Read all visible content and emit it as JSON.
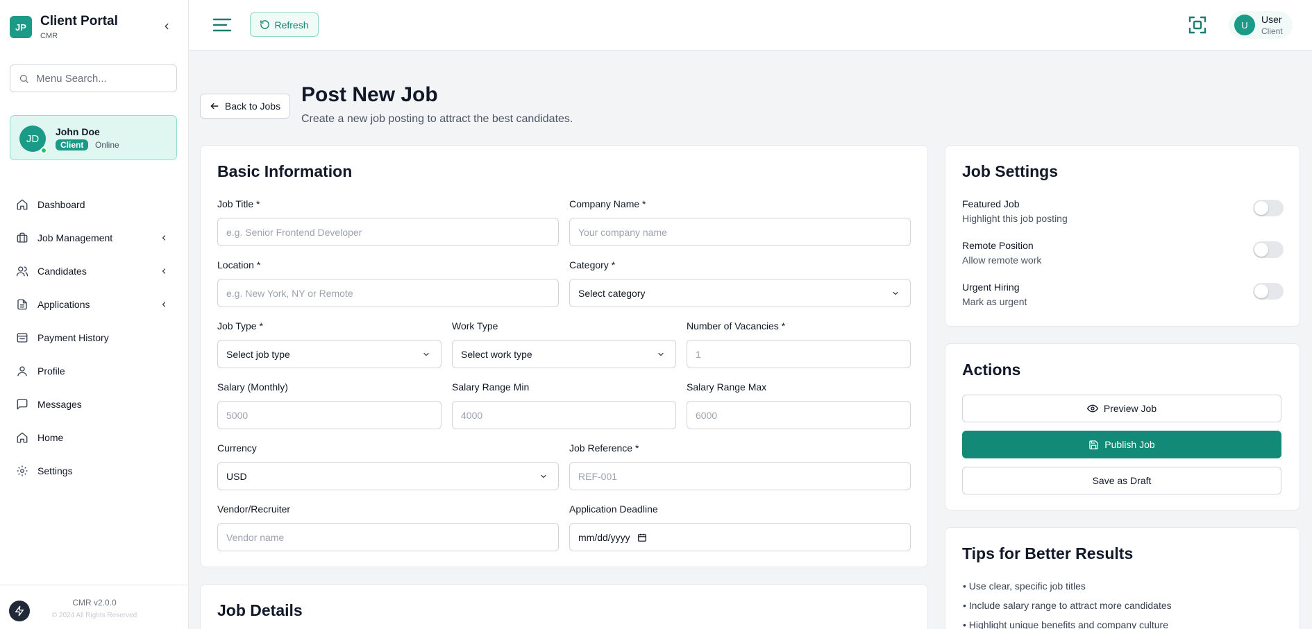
{
  "brand": {
    "logo": "JP",
    "title": "Client Portal",
    "subtitle": "CMR"
  },
  "search": {
    "placeholder": "Menu Search..."
  },
  "user": {
    "initials": "JD",
    "name": "John Doe",
    "role": "Client",
    "status": "Online"
  },
  "nav": {
    "items": [
      {
        "label": "Dashboard",
        "icon": "home-icon"
      },
      {
        "label": "Job Management",
        "icon": "briefcase-icon",
        "expandable": true
      },
      {
        "label": "Candidates",
        "icon": "users-icon",
        "expandable": true
      },
      {
        "label": "Applications",
        "icon": "file-icon",
        "expandable": true
      },
      {
        "label": "Payment History",
        "icon": "receipt-icon"
      },
      {
        "label": "Profile",
        "icon": "user-icon"
      },
      {
        "label": "Messages",
        "icon": "message-icon"
      },
      {
        "label": "Home",
        "icon": "home-icon"
      },
      {
        "label": "Settings",
        "icon": "gear-icon"
      }
    ]
  },
  "footer": {
    "version": "CMR v2.0.0",
    "copyright": "© 2024 All Rights Reserved"
  },
  "topbar": {
    "refresh_label": "Refresh",
    "user_initial": "U",
    "user_name": "User",
    "user_role": "Client"
  },
  "page": {
    "back_label": "Back to Jobs",
    "title": "Post New Job",
    "subtitle": "Create a new job posting to attract the best candidates."
  },
  "basic_info": {
    "title": "Basic Information",
    "job_title": {
      "label": "Job Title *",
      "placeholder": "e.g. Senior Frontend Developer"
    },
    "company_name": {
      "label": "Company Name *",
      "placeholder": "Your company name"
    },
    "location": {
      "label": "Location *",
      "placeholder": "e.g. New York, NY or Remote"
    },
    "category": {
      "label": "Category *",
      "value": "Select category"
    },
    "job_type": {
      "label": "Job Type *",
      "value": "Select job type"
    },
    "work_type": {
      "label": "Work Type",
      "value": "Select work type"
    },
    "vacancies": {
      "label": "Number of Vacancies *",
      "placeholder": "1"
    },
    "salary_monthly": {
      "label": "Salary (Monthly)",
      "placeholder": "5000"
    },
    "salary_min": {
      "label": "Salary Range Min",
      "placeholder": "4000"
    },
    "salary_max": {
      "label": "Salary Range Max",
      "placeholder": "6000"
    },
    "currency": {
      "label": "Currency",
      "value": "USD"
    },
    "job_reference": {
      "label": "Job Reference *",
      "placeholder": "REF-001"
    },
    "vendor": {
      "label": "Vendor/Recruiter",
      "placeholder": "Vendor name"
    },
    "deadline": {
      "label": "Application Deadline",
      "value": "mm/dd/yyyy"
    }
  },
  "job_details": {
    "title": "Job Details"
  },
  "job_settings": {
    "title": "Job Settings",
    "items": [
      {
        "title": "Featured Job",
        "desc": "Highlight this job posting",
        "enabled": false
      },
      {
        "title": "Remote Position",
        "desc": "Allow remote work",
        "enabled": false
      },
      {
        "title": "Urgent Hiring",
        "desc": "Mark as urgent",
        "enabled": false
      }
    ]
  },
  "actions": {
    "title": "Actions",
    "preview": "Preview Job",
    "publish": "Publish Job",
    "draft": "Save as Draft"
  },
  "tips": {
    "title": "Tips for Better Results",
    "items": [
      "• Use clear, specific job titles",
      "• Include salary range to attract more candidates",
      "• Highlight unique benefits and company culture"
    ]
  },
  "colors": {
    "accent": "#1b9a87",
    "accent_dark": "#138a78",
    "background": "#f3f4f6"
  }
}
